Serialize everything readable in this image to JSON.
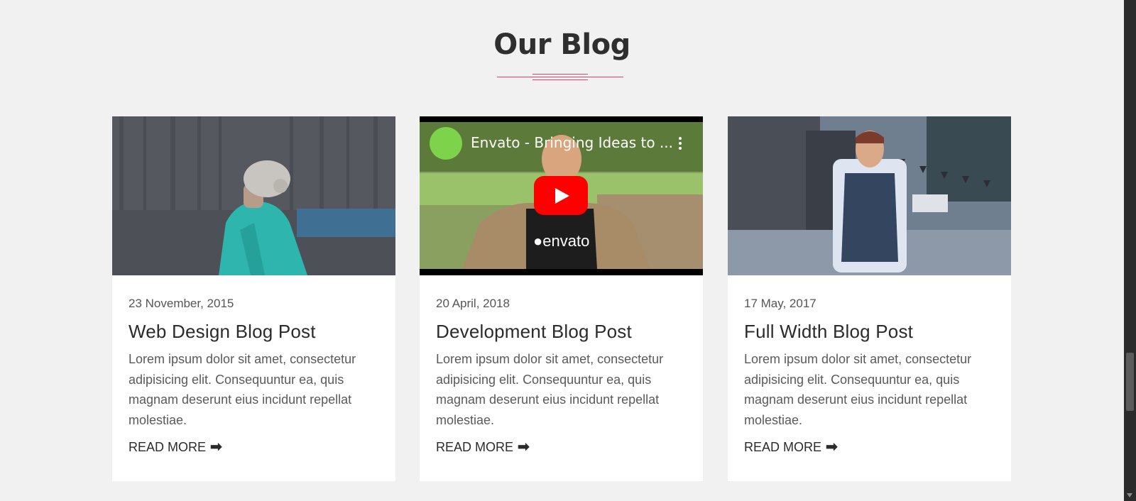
{
  "section": {
    "title": "Our Blog"
  },
  "posts": [
    {
      "date": "23 November, 2015",
      "title": "Web Design Blog Post",
      "excerpt": "Lorem ipsum dolor sit amet, consectetur adipisicing elit. Consequuntur ea, quis magnam deserunt eius incidunt repellat molestiae.",
      "read_more": "READ MORE",
      "media": "photo-person-teal-jacket"
    },
    {
      "date": "20 April, 2018",
      "title": "Development Blog Post",
      "excerpt": "Lorem ipsum dolor sit amet, consectetur adipisicing elit. Consequuntur ea, quis magnam deserunt eius incidunt repellat molestiae.",
      "read_more": "READ MORE",
      "media": "youtube-video",
      "video_title": "Envato - Bringing Ideas to ..."
    },
    {
      "date": "17 May, 2017",
      "title": "Full Width Blog Post",
      "excerpt": "Lorem ipsum dolor sit amet, consectetur adipisicing elit. Consequuntur ea, quis magnam deserunt eius incidunt repellat molestiae.",
      "read_more": "READ MORE",
      "media": "photo-man-vest-street"
    }
  ],
  "icons": {
    "read_more": "arrow-right-icon",
    "video_menu": "kebab-menu-icon",
    "play": "youtube-play-icon"
  },
  "colors": {
    "accent": "#e0416b",
    "heading": "#2f2f2f",
    "background": "#f1f1f1",
    "card": "#ffffff"
  }
}
